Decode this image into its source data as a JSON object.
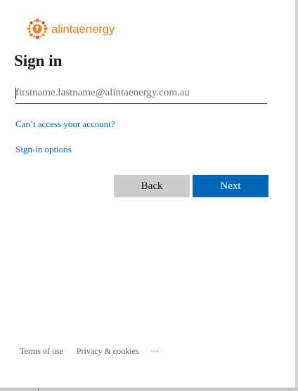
{
  "brand": {
    "logo_part1": "alinta",
    "logo_part2": "energy",
    "icon": "sun-star-icon",
    "color": "#f47a20"
  },
  "signin": {
    "title": "Sign in",
    "email_placeholder": "firstname.lastname@alintaenergy.com.au",
    "email_value": "",
    "cant_access_link": "Can’t access your account?",
    "signin_options_link": "Sign-in options"
  },
  "buttons": {
    "back_label": "Back",
    "next_label": "Next",
    "primary_color": "#0067b8",
    "secondary_color": "#cccccc"
  },
  "footer": {
    "terms_label": "Terms of use",
    "privacy_label": "Privacy & cookies",
    "more_label": "..."
  }
}
